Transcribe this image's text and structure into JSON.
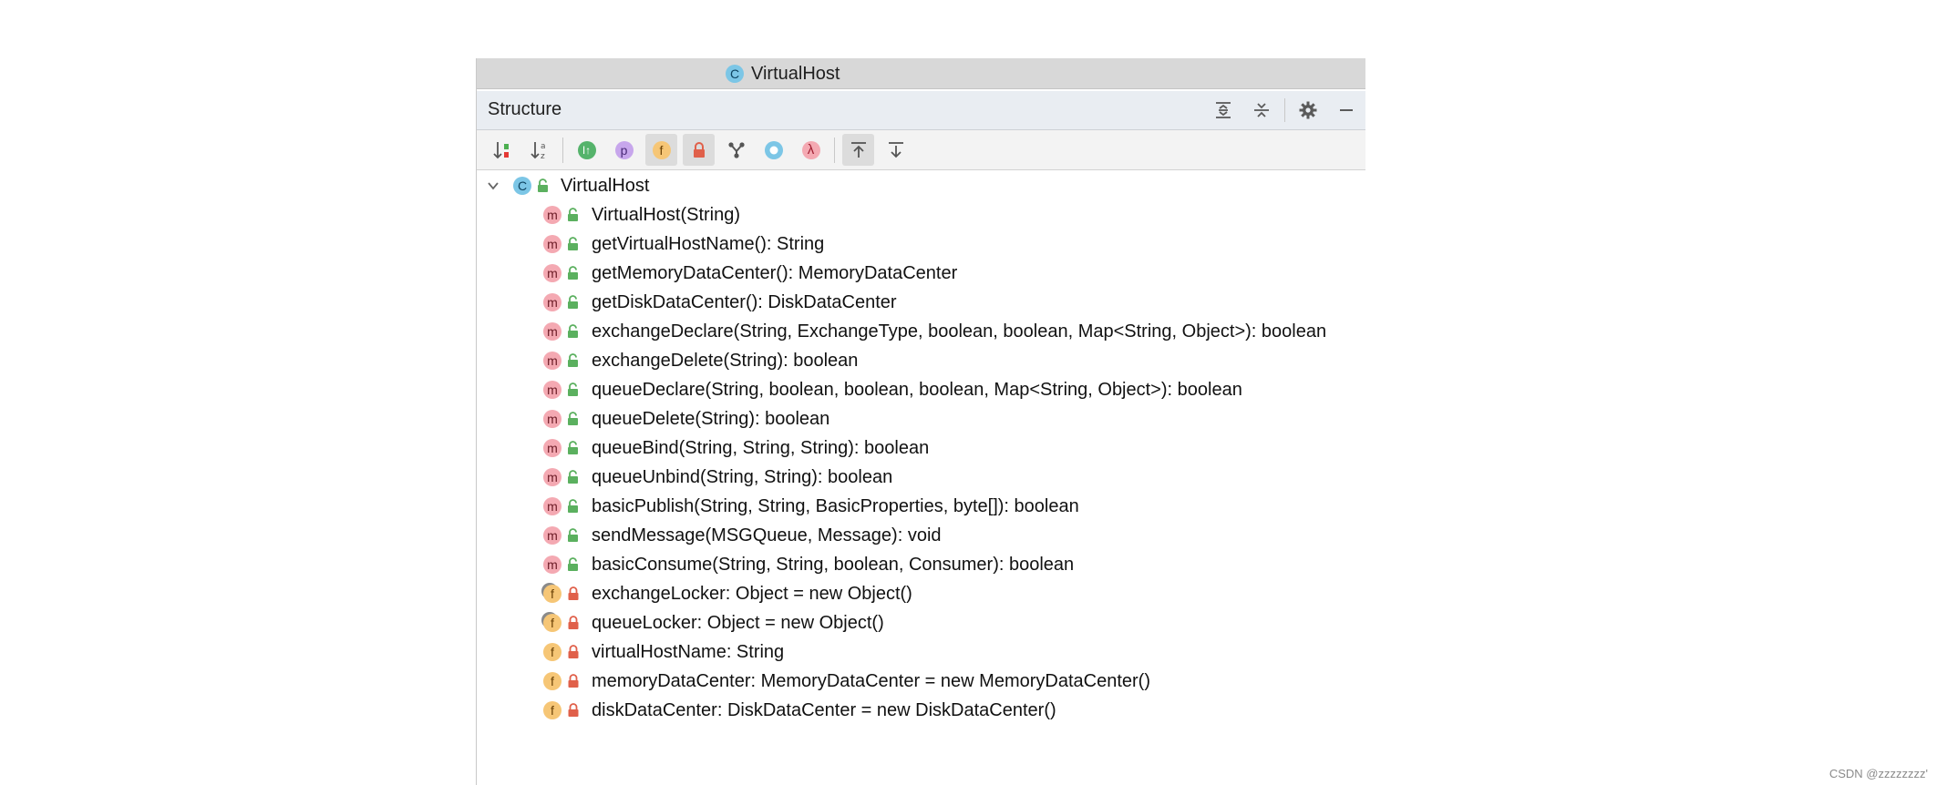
{
  "editor_tab": {
    "title": "VirtualHost",
    "icon": "class-icon"
  },
  "panel": {
    "title": "Structure",
    "actions": [
      {
        "name": "expand-all-icon"
      },
      {
        "name": "collapse-all-icon"
      },
      {
        "name": "gear-icon"
      },
      {
        "name": "minimize-icon"
      }
    ]
  },
  "toolbar": [
    {
      "name": "sort-by-visibility-icon",
      "active": false
    },
    {
      "name": "sort-alphabetically-icon",
      "active": false
    },
    {
      "name": "show-inherited-icon",
      "active": false
    },
    {
      "name": "show-properties-icon",
      "active": false
    },
    {
      "name": "show-fields-icon",
      "active": true
    },
    {
      "name": "show-non-public-icon",
      "active": true
    },
    {
      "name": "group-by-hierarchy-icon",
      "active": false
    },
    {
      "name": "show-anonymous-icon",
      "active": false
    },
    {
      "name": "show-lambdas-icon",
      "active": false
    },
    {
      "name": "autoscroll-to-source-icon",
      "active": true
    },
    {
      "name": "autoscroll-from-source-icon",
      "active": false
    }
  ],
  "tree": {
    "root": {
      "label": "VirtualHost",
      "kind": "class",
      "expanded": true
    },
    "members": [
      {
        "kind": "method",
        "visibility": "public",
        "label": "VirtualHost(String)"
      },
      {
        "kind": "method",
        "visibility": "public",
        "label": "getVirtualHostName(): String"
      },
      {
        "kind": "method",
        "visibility": "public",
        "label": "getMemoryDataCenter(): MemoryDataCenter"
      },
      {
        "kind": "method",
        "visibility": "public",
        "label": "getDiskDataCenter(): DiskDataCenter"
      },
      {
        "kind": "method",
        "visibility": "public",
        "label": "exchangeDeclare(String, ExchangeType, boolean, boolean, Map<String, Object>): boolean"
      },
      {
        "kind": "method",
        "visibility": "public",
        "label": "exchangeDelete(String): boolean"
      },
      {
        "kind": "method",
        "visibility": "public",
        "label": "queueDeclare(String, boolean, boolean, boolean, Map<String, Object>): boolean"
      },
      {
        "kind": "method",
        "visibility": "public",
        "label": "queueDelete(String): boolean"
      },
      {
        "kind": "method",
        "visibility": "public",
        "label": "queueBind(String, String, String): boolean"
      },
      {
        "kind": "method",
        "visibility": "public",
        "label": "queueUnbind(String, String): boolean"
      },
      {
        "kind": "method",
        "visibility": "public",
        "label": "basicPublish(String, String, BasicProperties, byte[]): boolean"
      },
      {
        "kind": "method",
        "visibility": "public",
        "label": "sendMessage(MSGQueue, Message): void"
      },
      {
        "kind": "method",
        "visibility": "public",
        "label": "basicConsume(String, String, boolean, Consumer): boolean"
      },
      {
        "kind": "field",
        "visibility": "private",
        "final": true,
        "label": "exchangeLocker: Object = new Object()"
      },
      {
        "kind": "field",
        "visibility": "private",
        "final": true,
        "label": "queueLocker: Object = new Object()"
      },
      {
        "kind": "field",
        "visibility": "private",
        "final": false,
        "label": "virtualHostName: String"
      },
      {
        "kind": "field",
        "visibility": "private",
        "final": false,
        "label": "memoryDataCenter: MemoryDataCenter = new MemoryDataCenter()"
      },
      {
        "kind": "field",
        "visibility": "private",
        "final": false,
        "label": "diskDataCenter: DiskDataCenter = new DiskDataCenter()"
      }
    ]
  },
  "colors": {
    "method_badge": "#f4a9b2",
    "field_badge": "#f6c676",
    "class_badge": "#7cc6e6",
    "public_lock": "#5bb05f",
    "private_lock": "#e0604a"
  },
  "watermark": "CSDN @zzzzzzzz'"
}
